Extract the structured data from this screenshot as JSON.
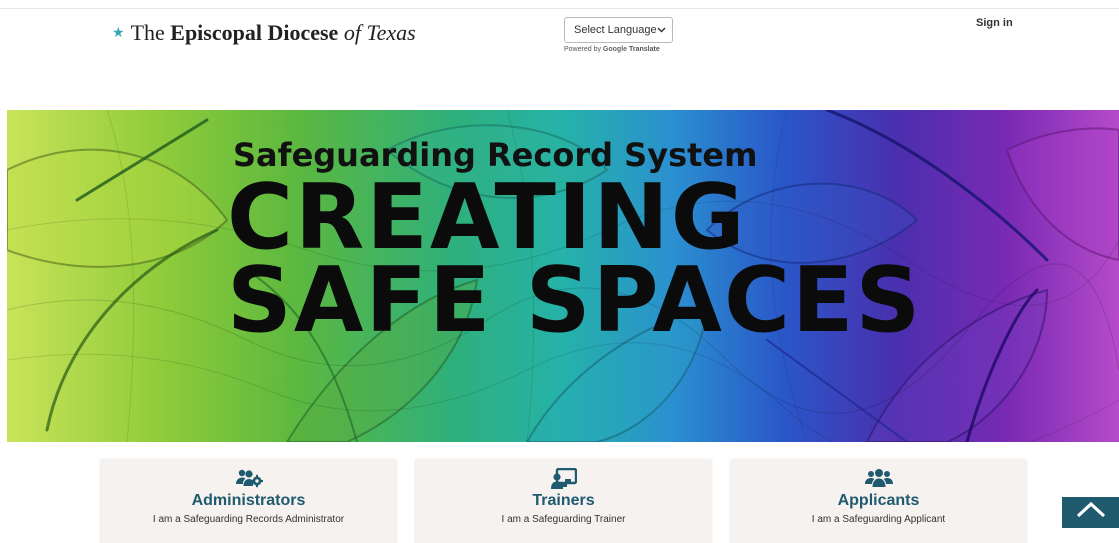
{
  "header": {
    "logo": {
      "prefix": "The ",
      "bold": "Episcopal Diocese",
      "italic": " of Texas",
      "star_glyph": "★",
      "star_color": "#3aa6b9"
    },
    "language_select": {
      "selected": "Select Language",
      "powered_by": "Powered by",
      "google_text": "Google",
      "translate_text": "Translate"
    },
    "sign_in": "Sign in"
  },
  "hero": {
    "subtitle": "Safeguarding Record System",
    "line1": "CREATING",
    "line2": "SAFE SPACES"
  },
  "cards": [
    {
      "title": "Administrators",
      "description": "I am a Safeguarding Records Administrator",
      "icon": "users-cog-icon"
    },
    {
      "title": "Trainers",
      "description": "I am a Safeguarding Trainer",
      "icon": "chalkboard-teacher-icon"
    },
    {
      "title": "Applicants",
      "description": "I am a Safeguarding Applicant",
      "icon": "users-icon"
    }
  ],
  "scroll_top": {
    "icon": "chevron-up-icon"
  },
  "colors": {
    "accent": "#1f5a6e",
    "card_bg": "#f5f2f0"
  }
}
